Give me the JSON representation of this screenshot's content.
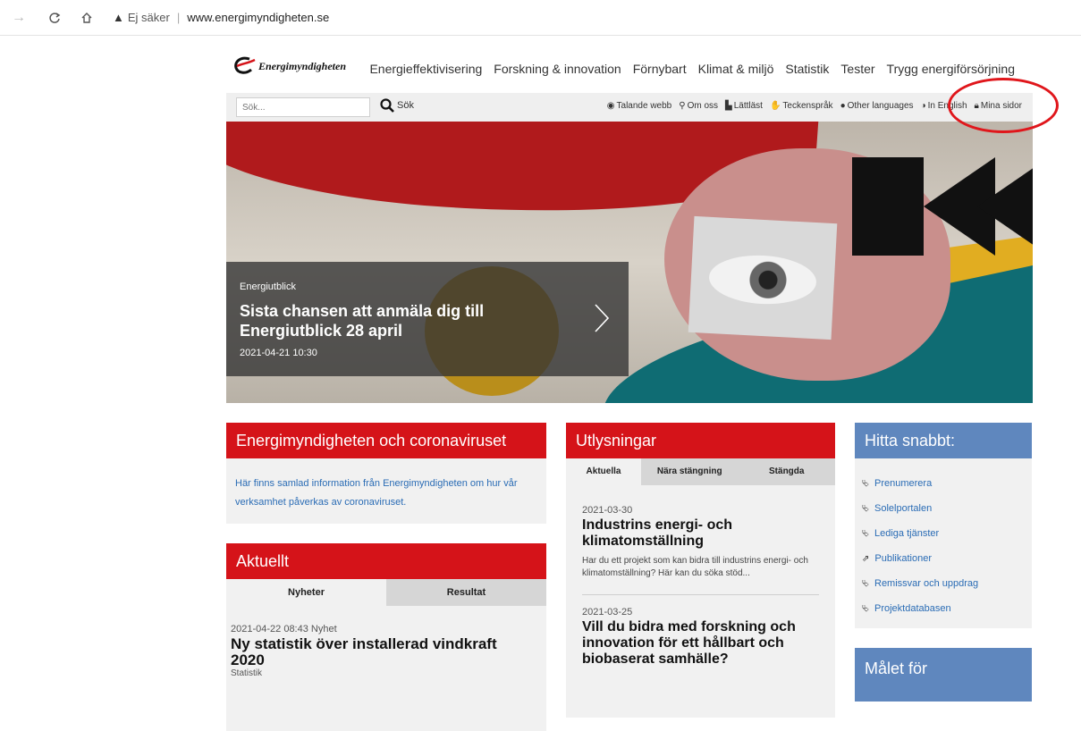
{
  "browser": {
    "security_label": "Ej säker",
    "url": "www.energimyndigheten.se"
  },
  "site": {
    "logo_text": "Energimyndigheten",
    "main_nav": [
      "Energieffektivisering",
      "Forskning & innovation",
      "Förnybart",
      "Klimat & miljö",
      "Statistik",
      "Tester",
      "Trygg energiförsörjning"
    ],
    "search": {
      "placeholder": "Sök...",
      "button_label": "Sök"
    },
    "tool_links": [
      {
        "icon": "speaker",
        "label": "Talande webb"
      },
      {
        "icon": "person",
        "label": "Om oss"
      },
      {
        "icon": "easy-read",
        "label": "Lättläst"
      },
      {
        "icon": "sign-language",
        "label": "Teckenspråk"
      },
      {
        "icon": "speech-bubble",
        "label": "Other languages"
      },
      {
        "icon": "globe",
        "label": "In English"
      },
      {
        "icon": "lock",
        "label": "Mina sidor"
      }
    ],
    "annotation_color": "#e0161b"
  },
  "hero": {
    "category": "Energiutblick",
    "title": "Sista chansen att anmäla dig till Energiutblick 28 april",
    "date": "2021-04-21 10:30"
  },
  "corona": {
    "heading": "Energimyndigheten och coronaviruset",
    "body": "Här finns samlad information från Energimyndigheten om hur vår verksamhet påverkas av coronaviruset."
  },
  "aktuellt": {
    "heading": "Aktuellt",
    "tabs": [
      "Nyheter",
      "Resultat"
    ],
    "items": [
      {
        "meta": "2021-04-22 08:43 Nyhet",
        "title": "Ny statistik över installerad vindkraft 2020",
        "category": "Statistik"
      }
    ]
  },
  "utlysningar": {
    "heading": "Utlysningar",
    "tabs": [
      "Aktuella",
      "Nära stängning",
      "Stängda"
    ],
    "items": [
      {
        "date": "2021-03-30",
        "title": "Industrins energi- och klimatomställning",
        "text": "Har du ett projekt som kan bidra till industrins energi- och klimatomställning? Här kan du söka stöd..."
      },
      {
        "date": "2021-03-25",
        "title": "Vill du bidra med forskning och innovation för ett hållbart och biobaserat samhälle?"
      }
    ]
  },
  "hitta": {
    "heading": "Hitta snabbt:",
    "links": [
      "Prenumerera",
      "Solelportalen",
      "Lediga tjänster",
      "Publikationer",
      "Remissvar och uppdrag",
      "Projektdatabasen"
    ]
  },
  "malet": {
    "heading": "Målet för"
  },
  "colors": {
    "brand_red": "#d51319",
    "link_blue": "#2a6cb5",
    "panel_blue": "#5f87be"
  }
}
